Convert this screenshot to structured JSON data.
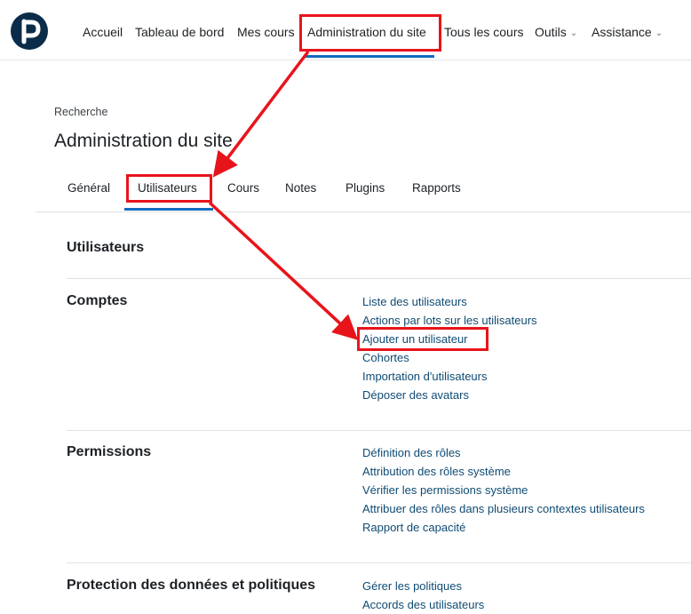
{
  "colors": {
    "brand": "#0b2d4a",
    "accent": "#0f6cbf",
    "link": "#0f4b73",
    "annotation": "#e8141b"
  },
  "navbar": {
    "logo_icon": "moodle-p-logo",
    "items": [
      {
        "label": "Accueil",
        "dropdown": false
      },
      {
        "label": "Tableau de bord",
        "dropdown": false
      },
      {
        "label": "Mes cours",
        "dropdown": false
      },
      {
        "label": "Administration du site",
        "dropdown": false,
        "active": true
      },
      {
        "label": "Tous les cours",
        "dropdown": false
      },
      {
        "label": "Outils",
        "dropdown": true
      },
      {
        "label": "Assistance",
        "dropdown": true
      }
    ],
    "chevron": "⌄"
  },
  "header": {
    "breadcrumb": "Recherche",
    "title": "Administration du site"
  },
  "tabs": [
    {
      "label": "Général"
    },
    {
      "label": "Utilisateurs",
      "active": true
    },
    {
      "label": "Cours"
    },
    {
      "label": "Notes"
    },
    {
      "label": "Plugins"
    },
    {
      "label": "Rapports"
    }
  ],
  "content": {
    "heading": "Utilisateurs",
    "sections": [
      {
        "title": "Comptes",
        "links": [
          "Liste des utilisateurs",
          "Actions par lots sur les utilisateurs",
          "Ajouter un utilisateur",
          "Cohortes",
          "Importation d'utilisateurs",
          "Déposer des avatars"
        ]
      },
      {
        "title": "Permissions",
        "links": [
          "Définition des rôles",
          "Attribution des rôles système",
          "Vérifier les permissions système",
          "Attribuer des rôles dans plusieurs contextes utilisateurs",
          "Rapport de capacité"
        ]
      },
      {
        "title": "Protection des données et politiques",
        "links": [
          "Gérer les politiques",
          "Accords des utilisateurs"
        ]
      }
    ]
  }
}
